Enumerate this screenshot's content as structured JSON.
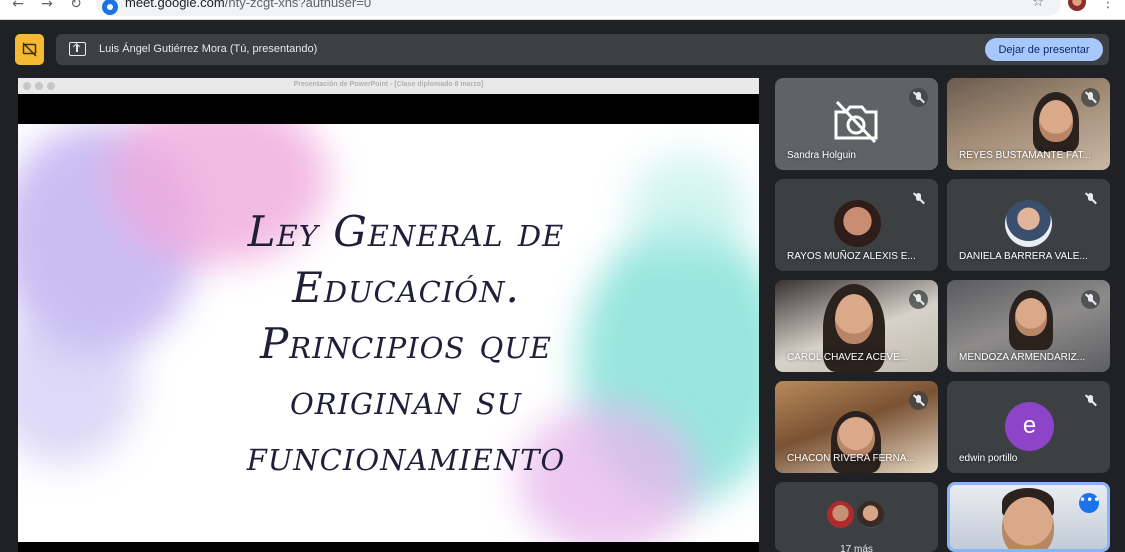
{
  "browser": {
    "url_host": "meet.google.com",
    "url_path": "/nty-zcgt-xhs?authuser=0",
    "back_icon": "←",
    "forward_icon": "→",
    "reload_icon": "↻",
    "star_icon": "☆",
    "menu_icon": "⋮"
  },
  "banner": {
    "presenter_text": "Luis Ángel Gutiérrez Mora (Tú, presentando)",
    "stop_button": "Dejar de presentar",
    "accent_color": "#f6b933"
  },
  "shared_window": {
    "window_title": "Presentación de PowerPoint - [Clase diplomado 8 marzo]",
    "slide_title_lines": [
      "Ley General de",
      "Educación.",
      "Principios que",
      "originan su",
      "funcionamiento"
    ]
  },
  "participants": [
    {
      "name": "Sandra Holguin",
      "camera": "off"
    },
    {
      "name": "REYES BUSTAMANTE FAT...",
      "camera": "on"
    },
    {
      "name": "RAYOS MUÑOZ ALEXIS E...",
      "camera": "off"
    },
    {
      "name": "DANIELA BARRERA VALE...",
      "camera": "off"
    },
    {
      "name": "CAROL CHAVEZ ACEVE...",
      "camera": "on"
    },
    {
      "name": "MENDOZA ARMENDARIZ...",
      "camera": "on"
    },
    {
      "name": "CHACON RIVERA FERNA...",
      "camera": "on"
    },
    {
      "name": "edwin portillo",
      "camera": "off",
      "initial": "e"
    },
    {
      "more_label": "17 más"
    },
    {
      "name": "",
      "camera": "on",
      "active": true
    }
  ]
}
